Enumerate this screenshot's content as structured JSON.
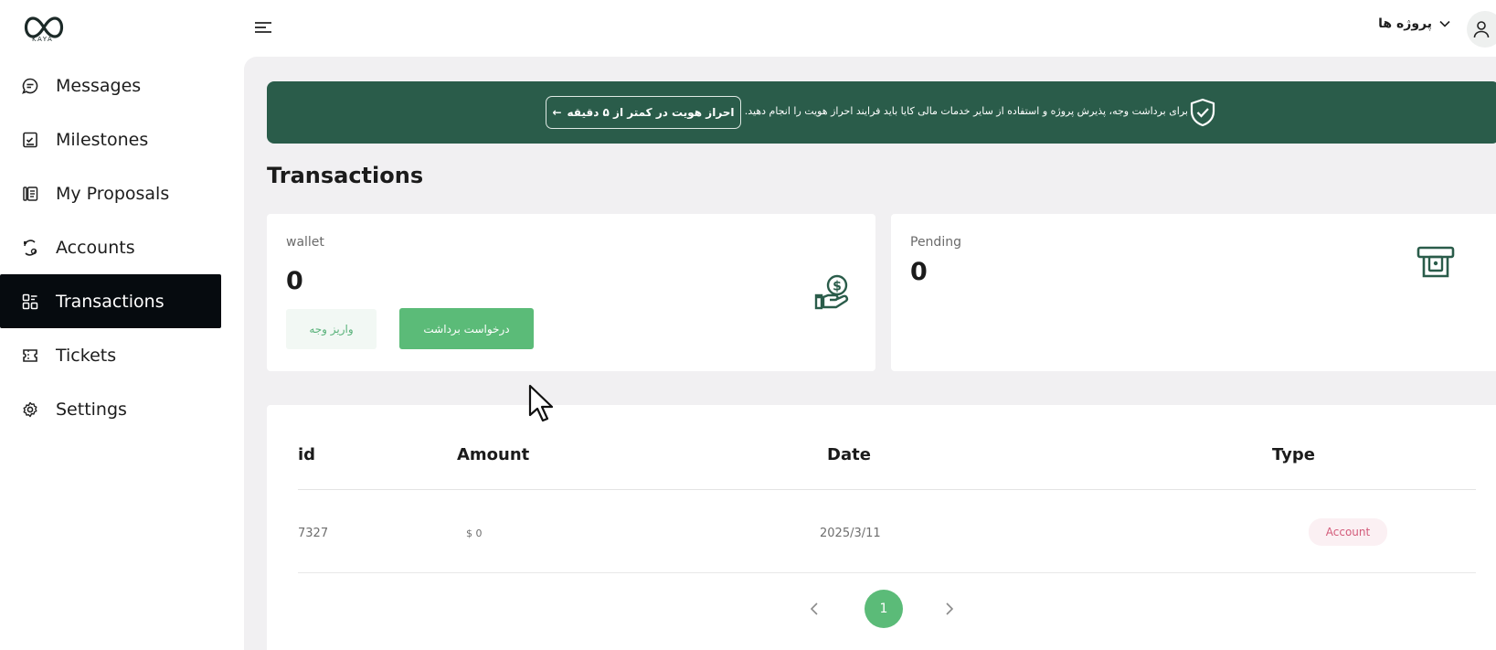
{
  "brand": {
    "logo_text": "KAYA"
  },
  "sidebar": {
    "items": [
      {
        "label": "Messages",
        "icon": "chat-icon",
        "active": false
      },
      {
        "label": "Milestones",
        "icon": "milestone-icon",
        "active": false
      },
      {
        "label": "My Proposals",
        "icon": "proposals-icon",
        "active": false
      },
      {
        "label": "Accounts",
        "icon": "accounts-icon",
        "active": false
      },
      {
        "label": "Transactions",
        "icon": "transactions-icon",
        "active": true
      },
      {
        "label": "Tickets",
        "icon": "ticket-icon",
        "active": false
      },
      {
        "label": "Settings",
        "icon": "gear-icon",
        "active": false
      }
    ]
  },
  "header": {
    "projects_label": "پروژه ها"
  },
  "banner": {
    "text": "برای برداشت وجه، پذیرش پروژه و استفاده از سایر خدمات مالی کایا باید فرایند احراز هویت را انجام دهید.",
    "button_label": "احراز هویت در کمتر از ۵ دقیقه",
    "button_arrow": "←"
  },
  "page": {
    "title": "Transactions"
  },
  "wallet": {
    "label": "wallet",
    "value": "0",
    "deposit_label": "واریز وجه",
    "withdraw_label": "درخواست برداشت"
  },
  "pending": {
    "label": "Pending",
    "value": "0"
  },
  "table": {
    "headers": {
      "id": "id",
      "amount": "Amount",
      "date": "Date",
      "type": "Type"
    },
    "rows": [
      {
        "id": "7327",
        "amount": "$ 0",
        "date": "2025/3/11",
        "type": "Account"
      }
    ]
  },
  "pagination": {
    "prev": "‹",
    "current": "1",
    "next": "›"
  },
  "colors": {
    "banner": "#2a5c4a",
    "accent_green": "#5bbb78",
    "active_nav": "#060b0f",
    "badge_text": "#d35b7a"
  }
}
